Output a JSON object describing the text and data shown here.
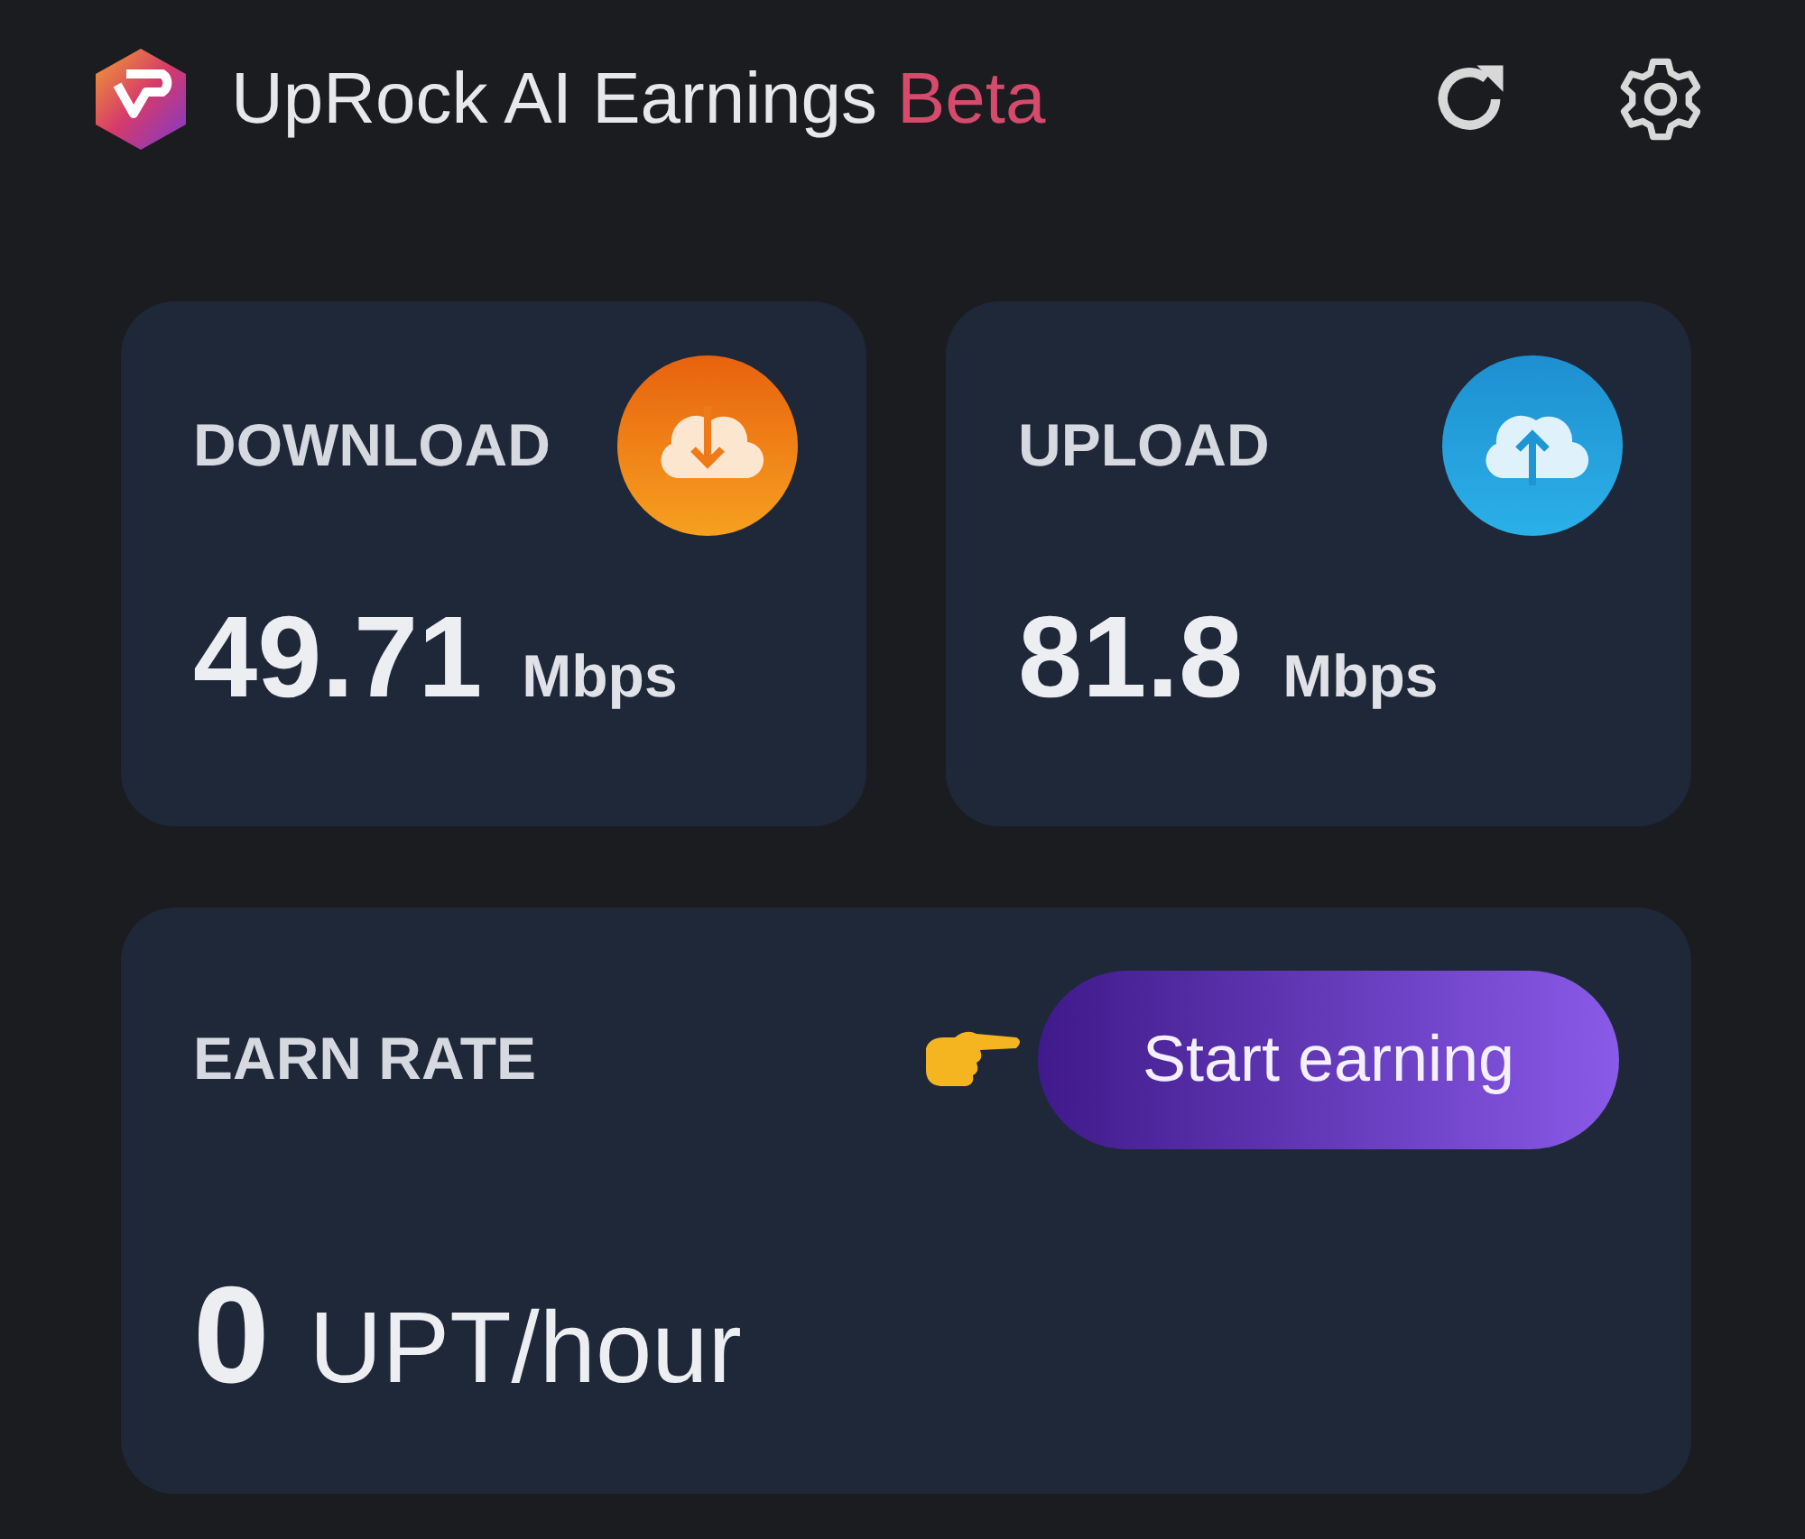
{
  "header": {
    "title": "UpRock AI Earnings",
    "badge": "Beta"
  },
  "speed_cards": [
    {
      "kind": "download",
      "label": "DOWNLOAD",
      "value": "49.71",
      "unit": "Mbps"
    },
    {
      "kind": "upload",
      "label": "UPLOAD",
      "value": "81.8",
      "unit": "Mbps"
    }
  ],
  "earn_rate": {
    "label": "EARN RATE",
    "value": "0",
    "unit": "UPT/hour",
    "button": "Start earning"
  }
}
